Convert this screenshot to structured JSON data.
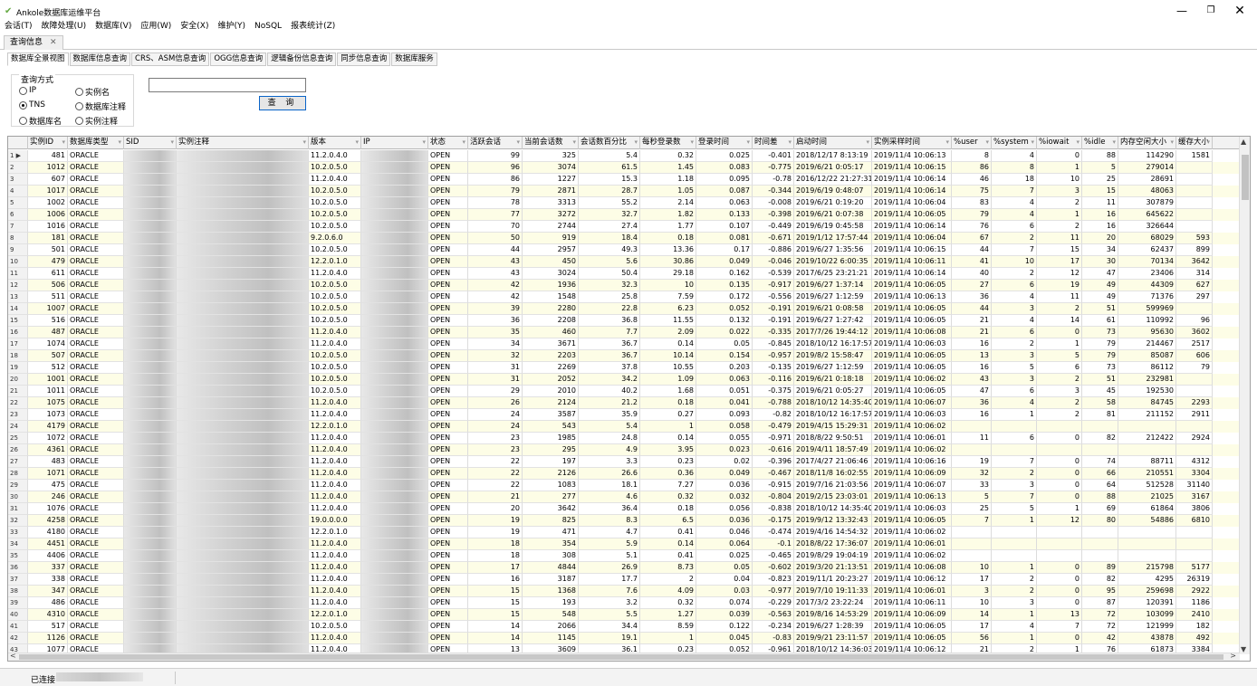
{
  "app": {
    "title": "Ankole数据库运维平台",
    "minimize": "—",
    "maximize": "❐",
    "close": "✕"
  },
  "menu": [
    "会话(T)",
    "故障处理(U)",
    "数据库(V)",
    "应用(W)",
    "安全(X)",
    "维护(Y)",
    "NoSQL",
    "报表统计(Z)"
  ],
  "doc_tab": {
    "label": "查询信息",
    "close": "✕"
  },
  "sub_tabs": [
    "数据库全景视图",
    "数据库信息查询",
    "CRS、ASM信息查询",
    "OGG信息查询",
    "逻辑备份信息查询",
    "同步信息查询",
    "数据库服务"
  ],
  "active_sub_tab": 0,
  "query": {
    "group_label": "查询方式",
    "options": [
      "IP",
      "实例名",
      "TNS",
      "数据库注释",
      "数据库名",
      "实例注释"
    ],
    "selected": "TNS",
    "input_value": "",
    "button_label": "查 询"
  },
  "grid": {
    "columns": [
      "",
      "实例ID",
      "数据库类型",
      "SID",
      "实例注释",
      "版本",
      "IP",
      "状态",
      "活跃会话",
      "当前会话数",
      "会话数百分比",
      "每秒登录数",
      "登录时间",
      "时间差",
      "启动时间",
      "实例采样时间",
      "%user",
      "%system",
      "%iowait",
      "%idle",
      "内存空闲大小",
      "缓存大小"
    ],
    "rows": [
      [
        "1 ▶",
        "481",
        "ORACLE",
        "",
        "",
        "11.2.0.4.0",
        "",
        "OPEN",
        "99",
        "325",
        "5.4",
        "0.32",
        "0.025",
        "-0.401",
        "2018/12/17 8:13:19",
        "2019/11/4 10:06:13",
        "8",
        "4",
        "0",
        "88",
        "114290",
        "1581"
      ],
      [
        "2",
        "1012",
        "ORACLE",
        "",
        "",
        "10.2.0.5.0",
        "",
        "OPEN",
        "96",
        "3074",
        "61.5",
        "1.45",
        "0.083",
        "-0.775",
        "2019/6/21 0:05:17",
        "2019/11/4 10:06:15",
        "86",
        "8",
        "1",
        "5",
        "279014",
        ""
      ],
      [
        "3",
        "607",
        "ORACLE",
        "",
        "",
        "11.2.0.4.0",
        "",
        "OPEN",
        "86",
        "1227",
        "15.3",
        "1.18",
        "0.095",
        "-0.78",
        "2016/12/22 21:27:31",
        "2019/11/4 10:06:14",
        "46",
        "18",
        "10",
        "25",
        "28691",
        ""
      ],
      [
        "4",
        "1017",
        "ORACLE",
        "",
        "",
        "10.2.0.5.0",
        "",
        "OPEN",
        "79",
        "2871",
        "28.7",
        "1.05",
        "0.087",
        "-0.344",
        "2019/6/19 0:48:07",
        "2019/11/4 10:06:14",
        "75",
        "7",
        "3",
        "15",
        "48063",
        ""
      ],
      [
        "5",
        "1002",
        "ORACLE",
        "",
        "",
        "10.2.0.5.0",
        "",
        "OPEN",
        "78",
        "3313",
        "55.2",
        "2.14",
        "0.063",
        "-0.008",
        "2019/6/21 0:19:20",
        "2019/11/4 10:06:04",
        "83",
        "4",
        "2",
        "11",
        "307879",
        ""
      ],
      [
        "6",
        "1006",
        "ORACLE",
        "",
        "",
        "10.2.0.5.0",
        "",
        "OPEN",
        "77",
        "3272",
        "32.7",
        "1.82",
        "0.133",
        "-0.398",
        "2019/6/21 0:07:38",
        "2019/11/4 10:06:05",
        "79",
        "4",
        "1",
        "16",
        "645622",
        ""
      ],
      [
        "7",
        "1016",
        "ORACLE",
        "",
        "",
        "10.2.0.5.0",
        "",
        "OPEN",
        "70",
        "2744",
        "27.4",
        "1.77",
        "0.107",
        "-0.449",
        "2019/6/19 0:45:58",
        "2019/11/4 10:06:14",
        "76",
        "6",
        "2",
        "16",
        "326644",
        ""
      ],
      [
        "8",
        "181",
        "ORACLE",
        "",
        "",
        "9.2.0.6.0",
        "",
        "OPEN",
        "50",
        "919",
        "18.4",
        "0.18",
        "0.081",
        "-0.671",
        "2019/1/12 17:57:44",
        "2019/11/4 10:06:04",
        "67",
        "2",
        "11",
        "20",
        "68029",
        "593"
      ],
      [
        "9",
        "501",
        "ORACLE",
        "",
        "",
        "10.2.0.5.0",
        "",
        "OPEN",
        "44",
        "2957",
        "49.3",
        "13.36",
        "0.17",
        "-0.886",
        "2019/6/27 1:35:56",
        "2019/11/4 10:06:15",
        "44",
        "7",
        "15",
        "34",
        "62437",
        "899"
      ],
      [
        "10",
        "479",
        "ORACLE",
        "",
        "",
        "12.2.0.1.0",
        "",
        "OPEN",
        "43",
        "450",
        "5.6",
        "30.86",
        "0.049",
        "-0.046",
        "2019/10/22 6:00:35",
        "2019/11/4 10:06:11",
        "41",
        "10",
        "17",
        "30",
        "70134",
        "3642"
      ],
      [
        "11",
        "611",
        "ORACLE",
        "",
        "",
        "11.2.0.4.0",
        "",
        "OPEN",
        "43",
        "3024",
        "50.4",
        "29.18",
        "0.162",
        "-0.539",
        "2017/6/25 23:21:21",
        "2019/11/4 10:06:14",
        "40",
        "2",
        "12",
        "47",
        "23406",
        "314"
      ],
      [
        "12",
        "506",
        "ORACLE",
        "",
        "",
        "10.2.0.5.0",
        "",
        "OPEN",
        "42",
        "1936",
        "32.3",
        "10",
        "0.135",
        "-0.917",
        "2019/6/27 1:37:14",
        "2019/11/4 10:06:05",
        "27",
        "6",
        "19",
        "49",
        "44309",
        "627"
      ],
      [
        "13",
        "511",
        "ORACLE",
        "",
        "",
        "10.2.0.5.0",
        "",
        "OPEN",
        "42",
        "1548",
        "25.8",
        "7.59",
        "0.172",
        "-0.556",
        "2019/6/27 1:12:59",
        "2019/11/4 10:06:13",
        "36",
        "4",
        "11",
        "49",
        "71376",
        "297"
      ],
      [
        "14",
        "1007",
        "ORACLE",
        "",
        "",
        "10.2.0.5.0",
        "",
        "OPEN",
        "39",
        "2280",
        "22.8",
        "6.23",
        "0.052",
        "-0.191",
        "2019/6/21 0:08:58",
        "2019/11/4 10:06:05",
        "44",
        "3",
        "2",
        "51",
        "599969",
        ""
      ],
      [
        "15",
        "516",
        "ORACLE",
        "",
        "",
        "10.2.0.5.0",
        "",
        "OPEN",
        "36",
        "2208",
        "36.8",
        "11.55",
        "0.132",
        "-0.191",
        "2019/6/27 1:27:42",
        "2019/11/4 10:06:05",
        "21",
        "4",
        "14",
        "61",
        "110992",
        "96"
      ],
      [
        "16",
        "487",
        "ORACLE",
        "",
        "",
        "11.2.0.4.0",
        "",
        "OPEN",
        "35",
        "460",
        "7.7",
        "2.09",
        "0.022",
        "-0.335",
        "2017/7/26 19:44:12",
        "2019/11/4 10:06:08",
        "21",
        "6",
        "0",
        "73",
        "95630",
        "3602"
      ],
      [
        "17",
        "1074",
        "ORACLE",
        "",
        "",
        "11.2.0.4.0",
        "",
        "OPEN",
        "34",
        "3671",
        "36.7",
        "0.14",
        "0.05",
        "-0.845",
        "2018/10/12 16:17:57",
        "2019/11/4 10:06:03",
        "16",
        "2",
        "1",
        "79",
        "214467",
        "2517"
      ],
      [
        "18",
        "507",
        "ORACLE",
        "",
        "",
        "10.2.0.5.0",
        "",
        "OPEN",
        "32",
        "2203",
        "36.7",
        "10.14",
        "0.154",
        "-0.957",
        "2019/8/2 15:58:47",
        "2019/11/4 10:06:05",
        "13",
        "3",
        "5",
        "79",
        "85087",
        "606"
      ],
      [
        "19",
        "512",
        "ORACLE",
        "",
        "",
        "10.2.0.5.0",
        "",
        "OPEN",
        "31",
        "2269",
        "37.8",
        "10.55",
        "0.203",
        "-0.135",
        "2019/6/27 1:12:59",
        "2019/11/4 10:06:05",
        "16",
        "5",
        "6",
        "73",
        "86112",
        "79"
      ],
      [
        "20",
        "1001",
        "ORACLE",
        "",
        "",
        "10.2.0.5.0",
        "",
        "OPEN",
        "31",
        "2052",
        "34.2",
        "1.09",
        "0.063",
        "-0.116",
        "2019/6/21 0:18:18",
        "2019/11/4 10:06:02",
        "43",
        "3",
        "2",
        "51",
        "232981",
        ""
      ],
      [
        "21",
        "1011",
        "ORACLE",
        "",
        "",
        "10.2.0.5.0",
        "",
        "OPEN",
        "29",
        "2010",
        "40.2",
        "1.68",
        "0.051",
        "-0.375",
        "2019/6/21 0:05:27",
        "2019/11/4 10:06:05",
        "47",
        "6",
        "3",
        "45",
        "192530",
        ""
      ],
      [
        "22",
        "1075",
        "ORACLE",
        "",
        "",
        "11.2.0.4.0",
        "",
        "OPEN",
        "26",
        "2124",
        "21.2",
        "0.18",
        "0.041",
        "-0.788",
        "2018/10/12 14:35:40",
        "2019/11/4 10:06:07",
        "36",
        "4",
        "2",
        "58",
        "84745",
        "2293"
      ],
      [
        "23",
        "1073",
        "ORACLE",
        "",
        "",
        "11.2.0.4.0",
        "",
        "OPEN",
        "24",
        "3587",
        "35.9",
        "0.27",
        "0.093",
        "-0.82",
        "2018/10/12 16:17:57",
        "2019/11/4 10:06:03",
        "16",
        "1",
        "2",
        "81",
        "211152",
        "2911"
      ],
      [
        "24",
        "4179",
        "ORACLE",
        "",
        "",
        "12.2.0.1.0",
        "",
        "OPEN",
        "24",
        "543",
        "5.4",
        "1",
        "0.058",
        "-0.479",
        "2019/4/15 15:29:31",
        "2019/11/4 10:06:02",
        "",
        "",
        "",
        "",
        "",
        ""
      ],
      [
        "25",
        "1072",
        "ORACLE",
        "",
        "",
        "11.2.0.4.0",
        "",
        "OPEN",
        "23",
        "1985",
        "24.8",
        "0.14",
        "0.055",
        "-0.971",
        "2018/8/22 9:50:51",
        "2019/11/4 10:06:01",
        "11",
        "6",
        "0",
        "82",
        "212422",
        "2924"
      ],
      [
        "26",
        "4361",
        "ORACLE",
        "",
        "",
        "11.2.0.4.0",
        "",
        "OPEN",
        "23",
        "295",
        "4.9",
        "3.95",
        "0.023",
        "-0.616",
        "2019/4/11 18:57:49",
        "2019/11/4 10:06:02",
        "",
        "",
        "",
        "",
        "",
        ""
      ],
      [
        "27",
        "483",
        "ORACLE",
        "",
        "",
        "11.2.0.4.0",
        "",
        "OPEN",
        "22",
        "197",
        "3.3",
        "0.23",
        "0.02",
        "-0.396",
        "2017/4/27 21:06:46",
        "2019/11/4 10:06:16",
        "19",
        "7",
        "0",
        "74",
        "88711",
        "4312"
      ],
      [
        "28",
        "1071",
        "ORACLE",
        "",
        "",
        "11.2.0.4.0",
        "",
        "OPEN",
        "22",
        "2126",
        "26.6",
        "0.36",
        "0.049",
        "-0.467",
        "2018/11/8 16:02:55",
        "2019/11/4 10:06:09",
        "32",
        "2",
        "0",
        "66",
        "210551",
        "3304"
      ],
      [
        "29",
        "475",
        "ORACLE",
        "",
        "",
        "11.2.0.4.0",
        "",
        "OPEN",
        "22",
        "1083",
        "18.1",
        "7.27",
        "0.036",
        "-0.915",
        "2019/7/16 21:03:56",
        "2019/11/4 10:06:07",
        "33",
        "3",
        "0",
        "64",
        "512528",
        "31140"
      ],
      [
        "30",
        "246",
        "ORACLE",
        "",
        "",
        "11.2.0.4.0",
        "",
        "OPEN",
        "21",
        "277",
        "4.6",
        "0.32",
        "0.032",
        "-0.804",
        "2019/2/15 23:03:01",
        "2019/11/4 10:06:13",
        "5",
        "7",
        "0",
        "88",
        "21025",
        "3167"
      ],
      [
        "31",
        "1076",
        "ORACLE",
        "",
        "",
        "11.2.0.4.0",
        "",
        "OPEN",
        "20",
        "3642",
        "36.4",
        "0.18",
        "0.056",
        "-0.838",
        "2018/10/12 14:35:40",
        "2019/11/4 10:06:03",
        "25",
        "5",
        "1",
        "69",
        "61864",
        "3806"
      ],
      [
        "32",
        "4258",
        "ORACLE",
        "",
        "",
        "19.0.0.0.0",
        "",
        "OPEN",
        "19",
        "825",
        "8.3",
        "6.5",
        "0.036",
        "-0.175",
        "2019/9/12 13:32:43",
        "2019/11/4 10:06:05",
        "7",
        "1",
        "12",
        "80",
        "54886",
        "6810"
      ],
      [
        "33",
        "4180",
        "ORACLE",
        "",
        "",
        "12.2.0.1.0",
        "",
        "OPEN",
        "19",
        "471",
        "4.7",
        "0.41",
        "0.046",
        "-0.474",
        "2019/4/16 14:54:32",
        "2019/11/4 10:06:02",
        "",
        "",
        "",
        "",
        "",
        ""
      ],
      [
        "34",
        "4451",
        "ORACLE",
        "",
        "",
        "11.2.0.4.0",
        "",
        "OPEN",
        "18",
        "354",
        "5.9",
        "0.14",
        "0.064",
        "-0.1",
        "2018/8/22 17:36:07",
        "2019/11/4 10:06:01",
        "",
        "",
        "",
        "",
        "",
        ""
      ],
      [
        "35",
        "4406",
        "ORACLE",
        "",
        "",
        "11.2.0.4.0",
        "",
        "OPEN",
        "18",
        "308",
        "5.1",
        "0.41",
        "0.025",
        "-0.465",
        "2019/8/29 19:04:19",
        "2019/11/4 10:06:02",
        "",
        "",
        "",
        "",
        "",
        ""
      ],
      [
        "36",
        "337",
        "ORACLE",
        "",
        "",
        "11.2.0.4.0",
        "",
        "OPEN",
        "17",
        "4844",
        "26.9",
        "8.73",
        "0.05",
        "-0.602",
        "2019/3/20 21:13:51",
        "2019/11/4 10:06:08",
        "10",
        "1",
        "0",
        "89",
        "215798",
        "5177"
      ],
      [
        "37",
        "338",
        "ORACLE",
        "",
        "",
        "11.2.0.4.0",
        "",
        "OPEN",
        "16",
        "3187",
        "17.7",
        "2",
        "0.04",
        "-0.823",
        "2019/11/1 20:23:27",
        "2019/11/4 10:06:12",
        "17",
        "2",
        "0",
        "82",
        "4295",
        "26319"
      ],
      [
        "38",
        "347",
        "ORACLE",
        "",
        "",
        "11.2.0.4.0",
        "",
        "OPEN",
        "15",
        "1368",
        "7.6",
        "4.09",
        "0.03",
        "-0.977",
        "2019/7/10 19:11:33",
        "2019/11/4 10:06:01",
        "3",
        "2",
        "0",
        "95",
        "259698",
        "2922"
      ],
      [
        "39",
        "486",
        "ORACLE",
        "",
        "",
        "11.2.0.4.0",
        "",
        "OPEN",
        "15",
        "193",
        "3.2",
        "0.32",
        "0.074",
        "-0.229",
        "2017/3/2 23:22:24",
        "2019/11/4 10:06:11",
        "10",
        "3",
        "0",
        "87",
        "120391",
        "1186"
      ],
      [
        "40",
        "4310",
        "ORACLE",
        "",
        "",
        "12.2.0.1.0",
        "",
        "OPEN",
        "15",
        "548",
        "5.5",
        "1.27",
        "0.039",
        "-0.563",
        "2019/8/16 14:53:29",
        "2019/11/4 10:06:09",
        "14",
        "1",
        "13",
        "72",
        "103099",
        "2410"
      ],
      [
        "41",
        "517",
        "ORACLE",
        "",
        "",
        "10.2.0.5.0",
        "",
        "OPEN",
        "14",
        "2066",
        "34.4",
        "8.59",
        "0.122",
        "-0.234",
        "2019/6/27 1:28:39",
        "2019/11/4 10:06:05",
        "17",
        "4",
        "7",
        "72",
        "121999",
        "182"
      ],
      [
        "42",
        "1126",
        "ORACLE",
        "",
        "",
        "11.2.0.4.0",
        "",
        "OPEN",
        "14",
        "1145",
        "19.1",
        "1",
        "0.045",
        "-0.83",
        "2019/9/21 23:11:57",
        "2019/11/4 10:06:05",
        "56",
        "1",
        "0",
        "42",
        "43878",
        "492"
      ],
      [
        "43",
        "1077",
        "ORACLE",
        "",
        "",
        "11.2.0.4.0",
        "",
        "OPEN",
        "13",
        "3609",
        "36.1",
        "0.23",
        "0.052",
        "-0.961",
        "2018/10/12 14:36:03",
        "2019/11/4 10:06:12",
        "21",
        "2",
        "1",
        "76",
        "61873",
        "3384"
      ]
    ]
  },
  "scroll": {
    "up": "▲",
    "down": "▼",
    "left": "<",
    "right": ">"
  },
  "status": {
    "text": "已连接"
  }
}
